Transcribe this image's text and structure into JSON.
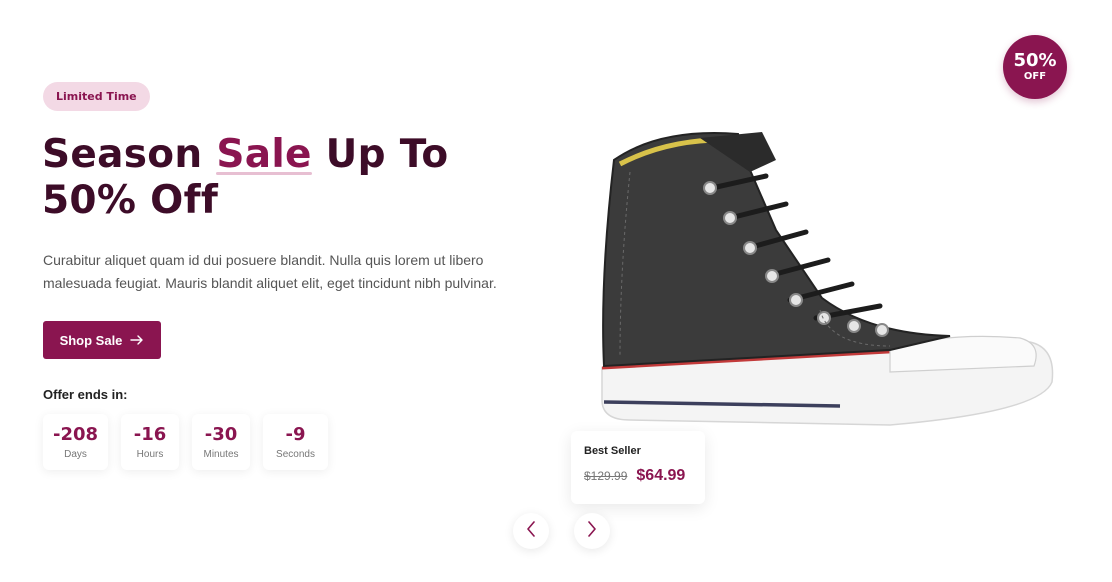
{
  "hero": {
    "badge": "Limited Time",
    "headline_part1": "Season ",
    "headline_highlight": "Sale",
    "headline_part2": " Up To 50% Off",
    "description": "Curabitur aliquet quam id dui posuere blandit. Nulla quis lorem ut libero malesuada feugiat. Mauris blandit aliquet elit, eget tincidunt nibh pulvinar.",
    "button_label": "Shop Sale",
    "button_icon": "arrow-right-icon",
    "offer_label": "Offer ends in:"
  },
  "countdown": [
    {
      "value": "-208",
      "unit": "Days"
    },
    {
      "value": "-16",
      "unit": "Hours"
    },
    {
      "value": "-30",
      "unit": "Minutes"
    },
    {
      "value": "-9",
      "unit": "Seconds"
    }
  ],
  "discount": {
    "percent": "50%",
    "label": "OFF"
  },
  "price_card": {
    "title": "Best Seller",
    "old_price": "$129.99",
    "new_price": "$64.99"
  },
  "carousel": {
    "prev_icon": "chevron-left-icon",
    "next_icon": "chevron-right-icon"
  },
  "colors": {
    "accent": "#8a1550",
    "badge_bg": "#f3d9e5",
    "heading": "#3d0c28"
  }
}
